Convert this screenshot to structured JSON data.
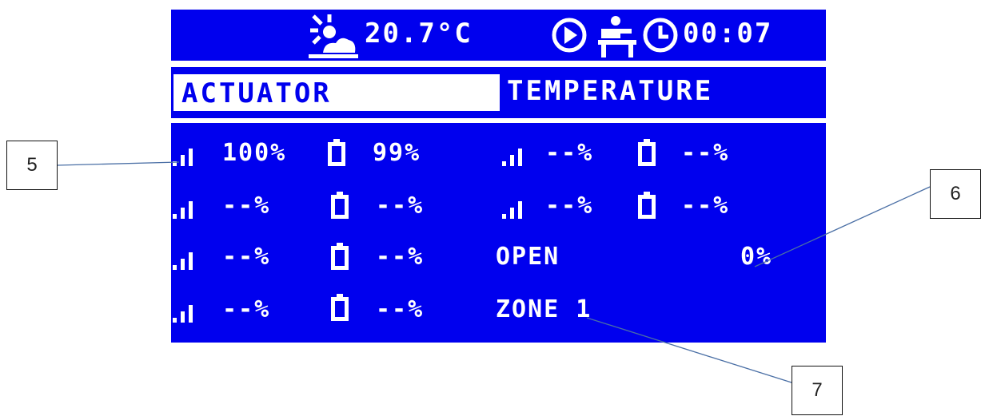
{
  "header": {
    "outside_temperature": "20.7°C",
    "time": "00:07",
    "icons": [
      "weather-sun-cloud-icon",
      "play-icon",
      "presence-person-icon",
      "clock-icon"
    ]
  },
  "tabs": {
    "actuator": "ACTUATOR",
    "temperature": "TEMPERATURE",
    "selected": "actuator"
  },
  "actuators": [
    {
      "signal": "100%",
      "battery": "99%"
    },
    {
      "signal": "--%",
      "battery": "--%"
    },
    {
      "signal": "--%",
      "battery": "--%"
    },
    {
      "signal": "--%",
      "battery": "--%"
    }
  ],
  "actuators_right": [
    {
      "signal": "--%",
      "battery": "--%"
    },
    {
      "signal": "--%",
      "battery": "--%"
    }
  ],
  "valve": {
    "state": "OPEN",
    "opening": "0%"
  },
  "zone": {
    "name": "ZONE 1"
  },
  "callouts": {
    "c5": "5",
    "c6": "6",
    "c7": "7"
  },
  "colors": {
    "lcd_background": "#0000ee",
    "lcd_foreground": "#ffffff"
  }
}
